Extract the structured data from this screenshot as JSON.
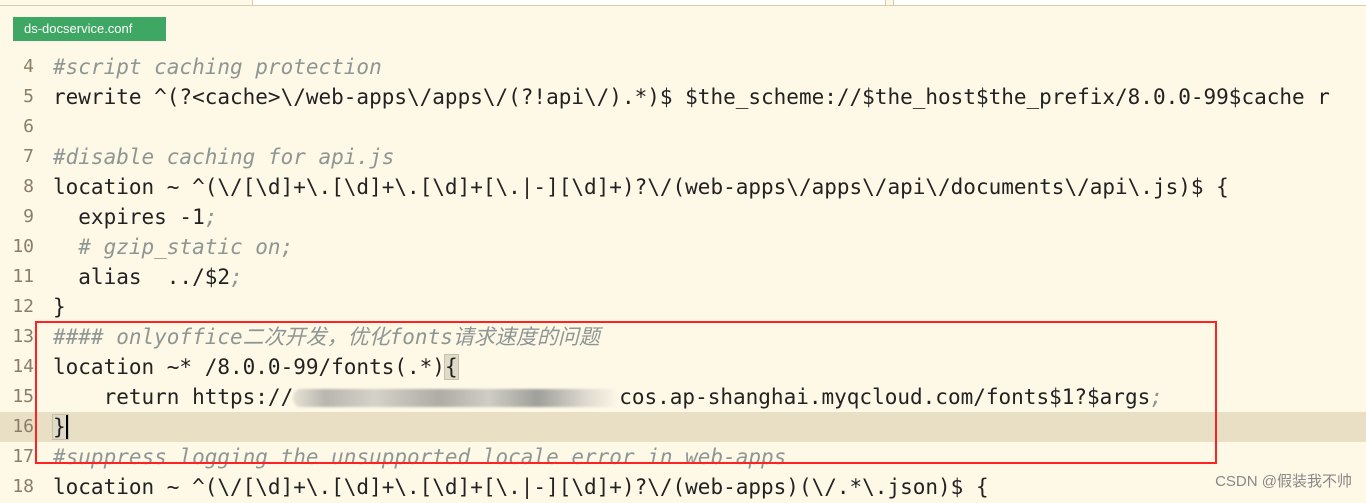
{
  "file_tag": "ds-docservice.conf",
  "lines": [
    {
      "n": "4",
      "text": "#script caching protection"
    },
    {
      "n": "5",
      "text": "rewrite ^(?<cache>\\/web-apps\\/apps\\/(?!api\\/).*)$ $the_scheme://$the_host$the_prefix/8.0.0-99$cache r"
    },
    {
      "n": "6",
      "text": ""
    },
    {
      "n": "7",
      "text": "#disable caching for api.js"
    },
    {
      "n": "8",
      "text": "location ~ ^(\\/[\\d]+\\.[\\d]+\\.[\\d]+[\\.|-][\\d]+)?\\/(web-apps\\/apps\\/api\\/documents\\/api\\.js)$ {"
    },
    {
      "n": "9",
      "text": "  expires -1",
      "semi": ";"
    },
    {
      "n": "10",
      "text": "  # gzip_static on;"
    },
    {
      "n": "11",
      "text": "  alias  ../$2",
      "semi": ";"
    },
    {
      "n": "12",
      "text": "}"
    },
    {
      "n": "13",
      "text": "#### onlyoffice二次开发，优化fonts请求速度的问题"
    },
    {
      "n": "14",
      "text": "location ~* /8.0.0-99/fonts(.*)",
      "bracket": "{"
    },
    {
      "n": "15",
      "text_before": "    return https://",
      "text_after": "cos.ap-shanghai.myqcloud.com/fonts$1?$args",
      "semi": ";"
    },
    {
      "n": "16",
      "text": "}"
    },
    {
      "n": "17",
      "text": "#suppress logging the unsupported locale error in web-apps"
    },
    {
      "n": "18",
      "text": "location ~ ^(\\/[\\d]+\\.[\\d]+\\.[\\d]+[\\.|-][\\d]+)?\\/(web-apps)(\\/.*\\.json)$ {"
    }
  ],
  "watermark": "CSDN @假装我不帅"
}
